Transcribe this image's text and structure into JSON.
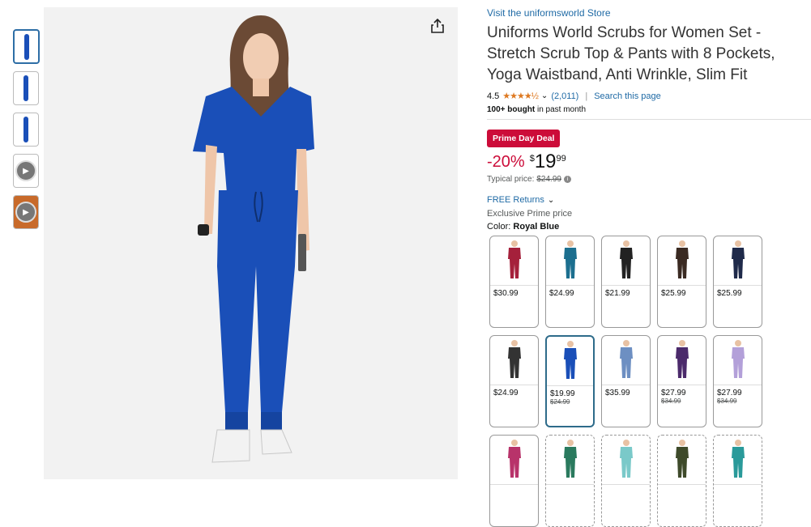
{
  "gallery": {
    "thumbnails": [
      {
        "kind": "image",
        "selected": true
      },
      {
        "kind": "image",
        "selected": false
      },
      {
        "kind": "image",
        "selected": false
      },
      {
        "kind": "video-thumb",
        "selected": false
      },
      {
        "kind": "video",
        "selected": false
      }
    ],
    "main_color": "#1a4fb8",
    "share_icon": "share-icon"
  },
  "product": {
    "store_link": "Visit the uniformsworld Store",
    "title": "Uniforms World Scrubs for Women Set - Stretch Scrub Top & Pants with 8 Pockets, Yoga Waistband, Anti Wrinkle, Slim Fit",
    "rating": "4.5",
    "stars": "★★★★½",
    "review_count": "(2,011)",
    "search_link": "Search this page",
    "bought_bold": "100+ bought",
    "bought_rest": "in past month"
  },
  "deal": {
    "badge": "Prime Day Deal",
    "discount": "-20%",
    "currency": "$",
    "whole": "19",
    "fraction": "99",
    "typical_label": "Typical price:",
    "typical_price": "$24.99"
  },
  "shipping": {
    "returns": "FREE Returns",
    "exclusive": "Exclusive Prime price"
  },
  "color": {
    "label": "Color:",
    "value": "Royal Blue"
  },
  "swatches": [
    {
      "color": "#a5203b",
      "price": "$30.99",
      "old": ""
    },
    {
      "color": "#1c6f8f",
      "price": "$24.99",
      "old": ""
    },
    {
      "color": "#222222",
      "price": "$21.99",
      "old": ""
    },
    {
      "color": "#3a2a22",
      "price": "$25.99",
      "old": ""
    },
    {
      "color": "#1f2a4a",
      "price": "$25.99",
      "old": ""
    },
    {
      "color": "#333333",
      "price": "$24.99",
      "old": ""
    },
    {
      "color": "#1a4fb8",
      "price": "$19.99",
      "old": "$24.99",
      "selected": true
    },
    {
      "color": "#6d8fc2",
      "price": "$35.99",
      "old": ""
    },
    {
      "color": "#4b2a6b",
      "price": "$27.99",
      "old": "$34.99"
    },
    {
      "color": "#b3a0d9",
      "price": "$27.99",
      "old": "$34.99"
    },
    {
      "color": "#b8336a",
      "price": "",
      "old": ""
    },
    {
      "color": "#2a7a5e",
      "price": "",
      "old": "",
      "dashed": true
    },
    {
      "color": "#7ac9c9",
      "price": "",
      "old": "",
      "dashed": true
    },
    {
      "color": "#3e4a2a",
      "price": "",
      "old": "",
      "dashed": true
    },
    {
      "color": "#2a9a9a",
      "price": "",
      "old": "",
      "dashed": true
    }
  ]
}
